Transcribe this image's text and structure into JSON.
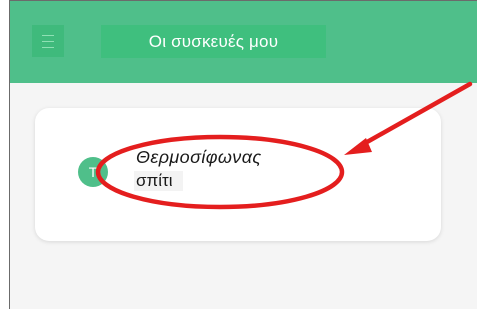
{
  "header": {
    "title": "Οι συσκευές μου",
    "menu_icon": "hamburger-menu-icon"
  },
  "devices": [
    {
      "avatar_letter": "Τ",
      "name": "Θερμοσίφωνας",
      "location": "σπίτι"
    }
  ],
  "colors": {
    "header_bg": "#4fbf8a",
    "title_bg": "#3fbf7e",
    "annotation_red": "#e41e1e"
  }
}
